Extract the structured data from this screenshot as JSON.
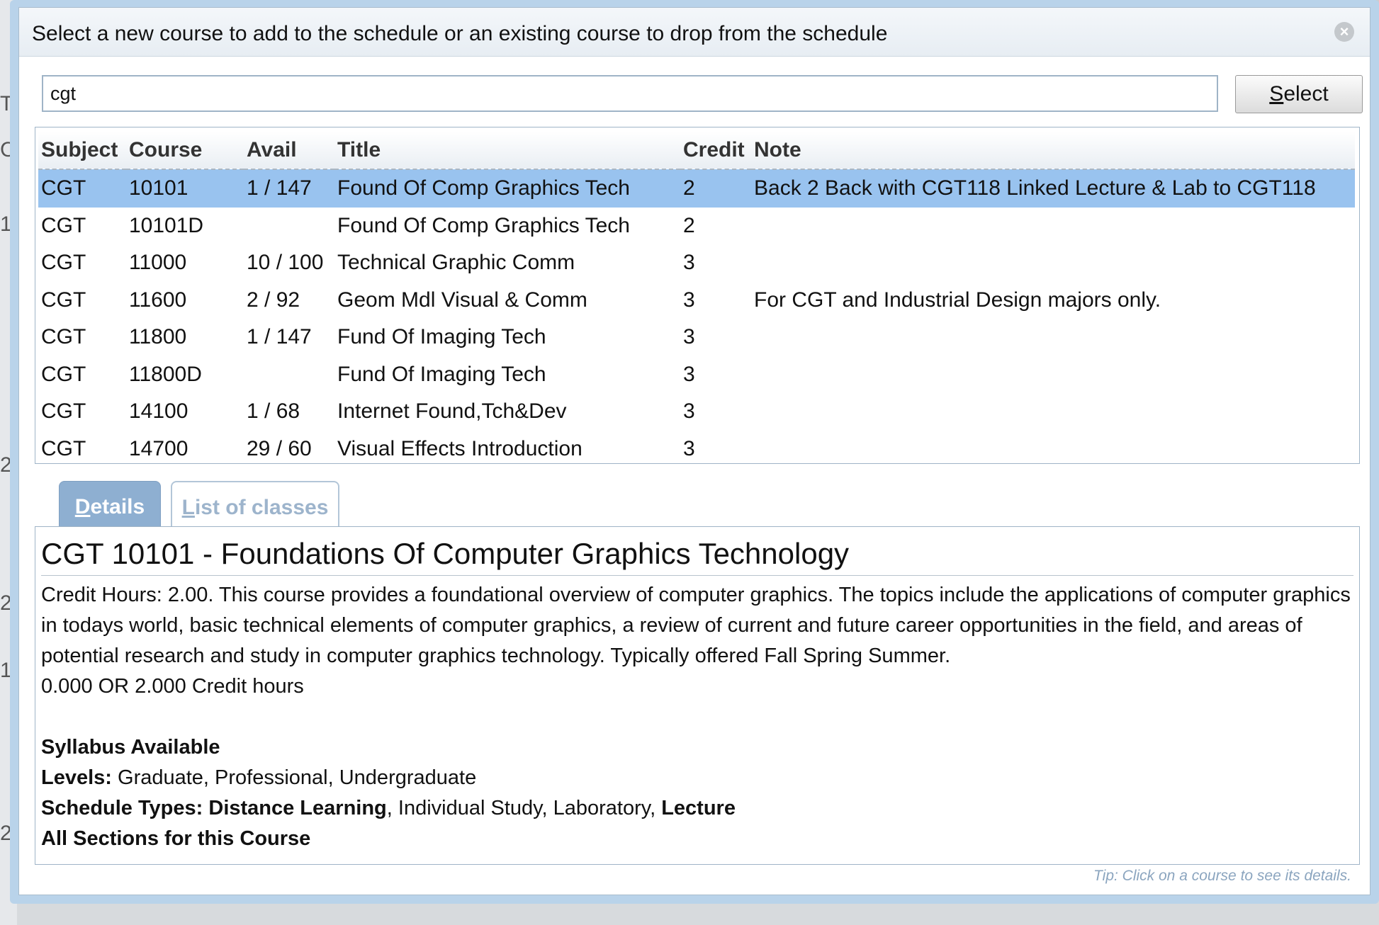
{
  "dialog": {
    "title": "Select a new course to add to the schedule or an existing course to drop from the schedule",
    "close_icon": "×"
  },
  "search": {
    "value": "cgt"
  },
  "select_button": {
    "accel": "S",
    "rest": "elect"
  },
  "table": {
    "headers": [
      "Subject",
      "Course",
      "Avail",
      "Title",
      "Credit",
      "Note"
    ],
    "rows": [
      {
        "subject": "CGT",
        "course": "10101",
        "avail": "1 / 147",
        "title": "Found Of Comp Graphics Tech",
        "credit": "2",
        "note": "Back 2 Back with CGT118 Linked Lecture & Lab to CGT118"
      },
      {
        "subject": "CGT",
        "course": "10101D",
        "avail": "",
        "title": "Found Of Comp Graphics Tech",
        "credit": "2",
        "note": ""
      },
      {
        "subject": "CGT",
        "course": "11000",
        "avail": "10 / 100",
        "title": "Technical Graphic Comm",
        "credit": "3",
        "note": ""
      },
      {
        "subject": "CGT",
        "course": "11600",
        "avail": "2 / 92",
        "title": "Geom Mdl Visual & Comm",
        "credit": "3",
        "note": "For CGT and Industrial Design majors only."
      },
      {
        "subject": "CGT",
        "course": "11800",
        "avail": "1 / 147",
        "title": "Fund Of Imaging Tech",
        "credit": "3",
        "note": ""
      },
      {
        "subject": "CGT",
        "course": "11800D",
        "avail": "",
        "title": "Fund Of Imaging Tech",
        "credit": "3",
        "note": ""
      },
      {
        "subject": "CGT",
        "course": "14100",
        "avail": "1 / 68",
        "title": "Internet Found,Tch&Dev",
        "credit": "3",
        "note": ""
      },
      {
        "subject": "CGT",
        "course": "14700",
        "avail": "29 / 60",
        "title": "Visual Effects Introduction",
        "credit": "3",
        "note": ""
      }
    ]
  },
  "tabs": {
    "details": {
      "accel": "D",
      "rest": "etails"
    },
    "classes": {
      "accel": "L",
      "rest": "ist of classes"
    }
  },
  "details": {
    "heading": "CGT 10101 - Foundations Of Computer Graphics Technology",
    "description": "Credit Hours: 2.00. This course provides a foundational overview of computer graphics. The topics include the applications of computer graphics in todays world, basic technical elements of computer graphics, a review of current and future career opportunities in the field, and areas of potential research and study in computer graphics technology. Typically offered Fall Spring Summer.",
    "credit_hours": "0.000 OR 2.000 Credit hours",
    "syllabus": "Syllabus Available",
    "levels_label": "Levels:",
    "levels_value": " Graduate, Professional, Undergraduate",
    "schedule_types_label": "Schedule Types:",
    "schedule_types": [
      {
        "text": " Distance Learning",
        "bold": true
      },
      {
        "text": ", Individual Study, Laboratory, ",
        "bold": false
      },
      {
        "text": "Lecture",
        "bold": true
      }
    ],
    "all_sections": "All Sections for this Course"
  },
  "tip": "Tip: Click on a course to see its details.",
  "background": {
    "fragments": [
      "Ti",
      "C",
      "1",
      "2",
      "2",
      "1",
      "2"
    ]
  }
}
